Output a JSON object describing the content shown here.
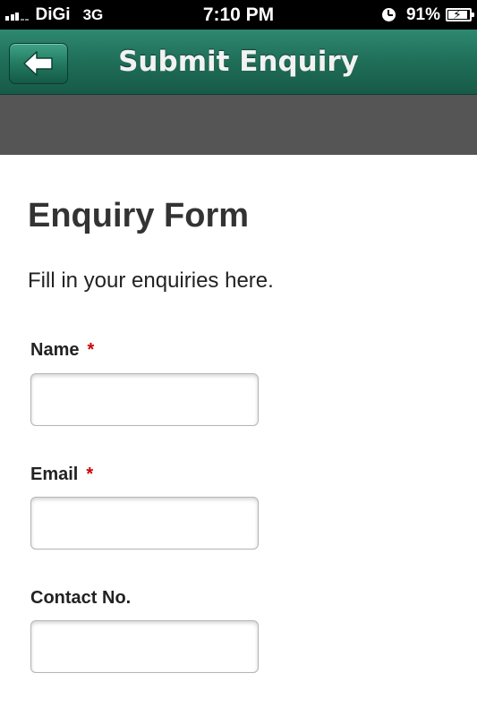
{
  "status_bar": {
    "carrier": "DiGi",
    "network": "3G",
    "time": "7:10 PM",
    "battery_percent": "91%",
    "battery_level": 0.91,
    "signal_bars_active": 3,
    "signal_bars_total": 5
  },
  "nav_bar": {
    "title": "Submit Enquiry",
    "back_icon": "arrow-left-icon",
    "color": "#1f6e58"
  },
  "form": {
    "title": "Enquiry Form",
    "intro": "Fill in your enquiries here.",
    "required_marker": "*",
    "required_color": "#cc0000",
    "fields": [
      {
        "label": "Name",
        "required": true,
        "value": "",
        "placeholder": ""
      },
      {
        "label": "Email",
        "required": true,
        "value": "",
        "placeholder": ""
      },
      {
        "label": "Contact No.",
        "required": false,
        "value": "",
        "placeholder": ""
      }
    ]
  }
}
